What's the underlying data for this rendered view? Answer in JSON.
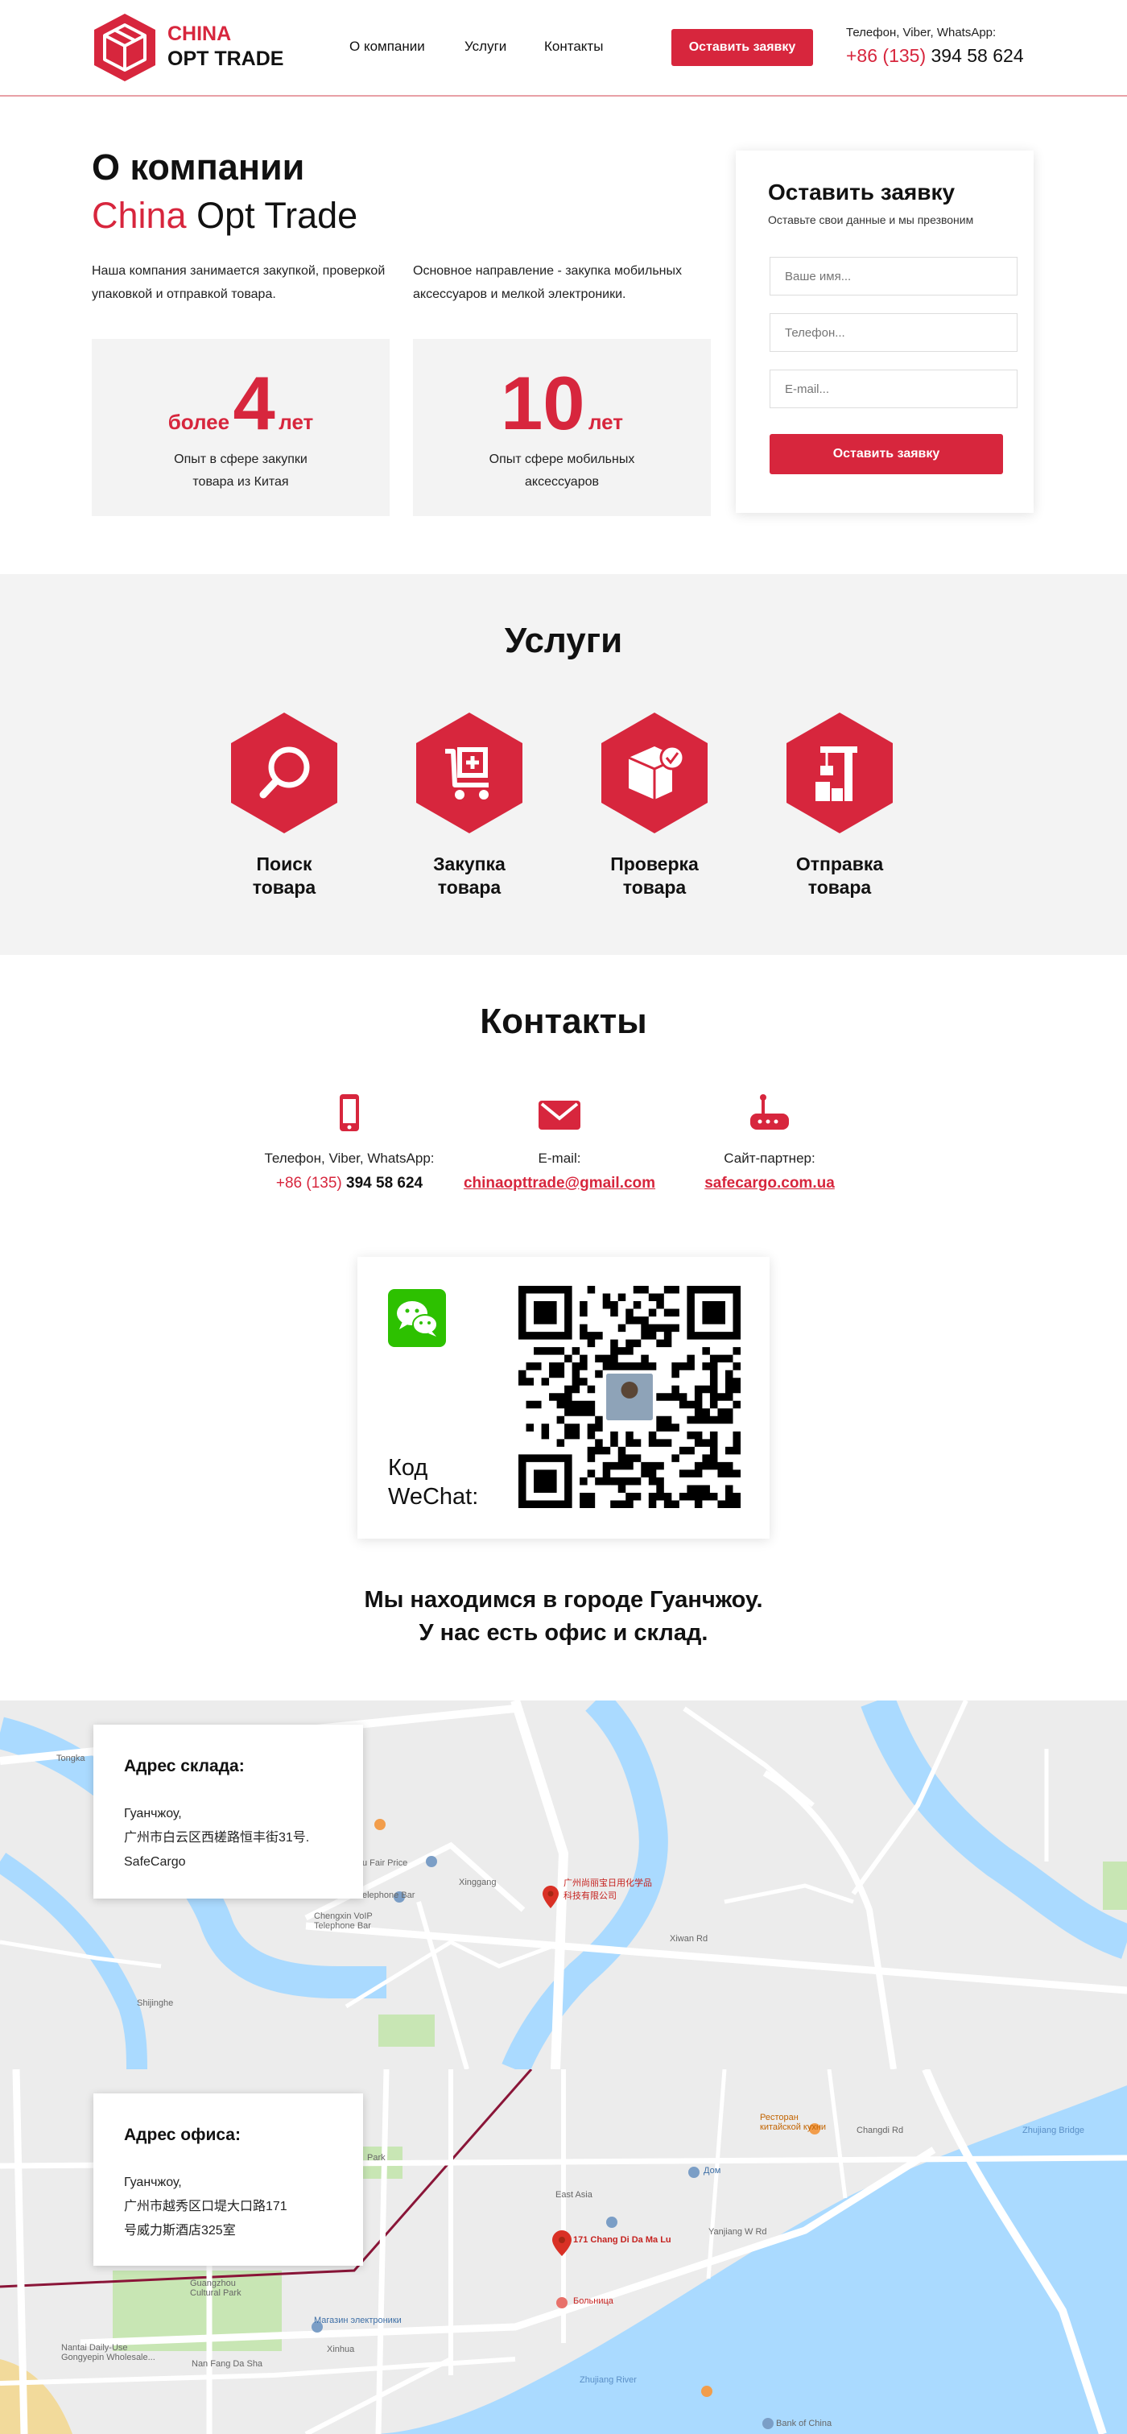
{
  "header": {
    "logo_line1": "CHINA",
    "logo_line2": "OPT TRADE",
    "nav": [
      "О компании",
      "Услуги",
      "Контакты"
    ],
    "cta": "Оставить заявку",
    "phone_label": "Телефон, Viber, WhatsApp:",
    "phone_prefix": "+86 (135)",
    "phone_number": "394 58 624"
  },
  "about": {
    "title_line1": "О компании",
    "title_brand": "China",
    "title_rest": "Opt Trade",
    "para1": "Наша компания занимается закупкой, проверкой упаковкой и отправкой товара.",
    "para2": "Основное направление - закупка мобильных аксессуаров и мелкой электроники.",
    "stats": [
      {
        "prefix": "более",
        "number": "4",
        "suffix": "лет",
        "caption": "Опыт в сфере закупки товара из Китая"
      },
      {
        "prefix": "",
        "number": "10",
        "suffix": "лет",
        "caption": "Опыт сфере мобильных аксессуаров"
      }
    ]
  },
  "form": {
    "title": "Оставить заявку",
    "subtitle": "Оставьте свои данные и мы презвоним",
    "name_placeholder": "Ваше имя...",
    "phone_placeholder": "Телефон...",
    "email_placeholder": "E-mail...",
    "submit": "Оставить заявку"
  },
  "services": {
    "title": "Услуги",
    "items": [
      {
        "line1": "Поиск",
        "line2": "товара",
        "icon": "search-icon"
      },
      {
        "line1": "Закупка",
        "line2": "товара",
        "icon": "cart-icon"
      },
      {
        "line1": "Проверка",
        "line2": "товара",
        "icon": "box-check-icon"
      },
      {
        "line1": "Отправка",
        "line2": "товара",
        "icon": "crane-icon"
      }
    ]
  },
  "contacts": {
    "title": "Контакты",
    "phone": {
      "label": "Телефон, Viber, WhatsApp:",
      "prefix": "+86 (135)",
      "number": "394 58 624"
    },
    "email": {
      "label": "E-mail:",
      "value": "chinaopttrade@gmail.com"
    },
    "partner": {
      "label": "Сайт-партнер:",
      "value": "safecargo.com.ua"
    },
    "wechat_label_line1": "Код",
    "wechat_label_line2": "WeChat:",
    "city_line1": "Мы находимся в городе Гуанчжоу.",
    "city_line2": "У нас есть офис и склад."
  },
  "warehouse": {
    "title": "Адрес склада:",
    "line1": "Гуанчжоу,",
    "line2": "广州市白云区西槎路恒丰街31号.",
    "line3": "SafeCargo"
  },
  "office": {
    "title": "Адрес офиса:",
    "line1": "Гуанчжоу,",
    "line2": "广州市越秀区口堤大口路171",
    "line3": "号威力斯酒店325室"
  },
  "map1_labels": {
    "tongka": "Tongka",
    "pin_name": "广州尚丽宝日用化学品科技有限公司",
    "fair_price": "u Fair Price",
    "telephone_bar": "elephone Bar",
    "chengxin": "Chengxin VoIP Telephone Bar",
    "xiwan": "Xiwan Rd",
    "shijinghe": "Shijinghe",
    "xinggang": "Xinggang"
  },
  "map2_labels": {
    "pin_name": "171 Chang Di Da Ma Lu",
    "restaurant": "Ресторан китайской кухни",
    "dom": "Дом",
    "east_asia": "East Asia",
    "hospital": "Больница",
    "electronics": "Магазин электроники",
    "culture_park": "Guangzhou Cultural Park",
    "nantai": "Nantai Daily-Use Gongyepin Wholesale...",
    "nanfang": "Nan Fang Da Sha",
    "xinhua": "Xinhua",
    "yanjiang": "Yanjiang W Rd",
    "changdi": "Changdi Rd",
    "zhujiang_river": "Zhujiang River",
    "zhujiang_bridge": "Zhujiang Bridge",
    "bank": "Bank of China",
    "rd_park": "Park"
  }
}
